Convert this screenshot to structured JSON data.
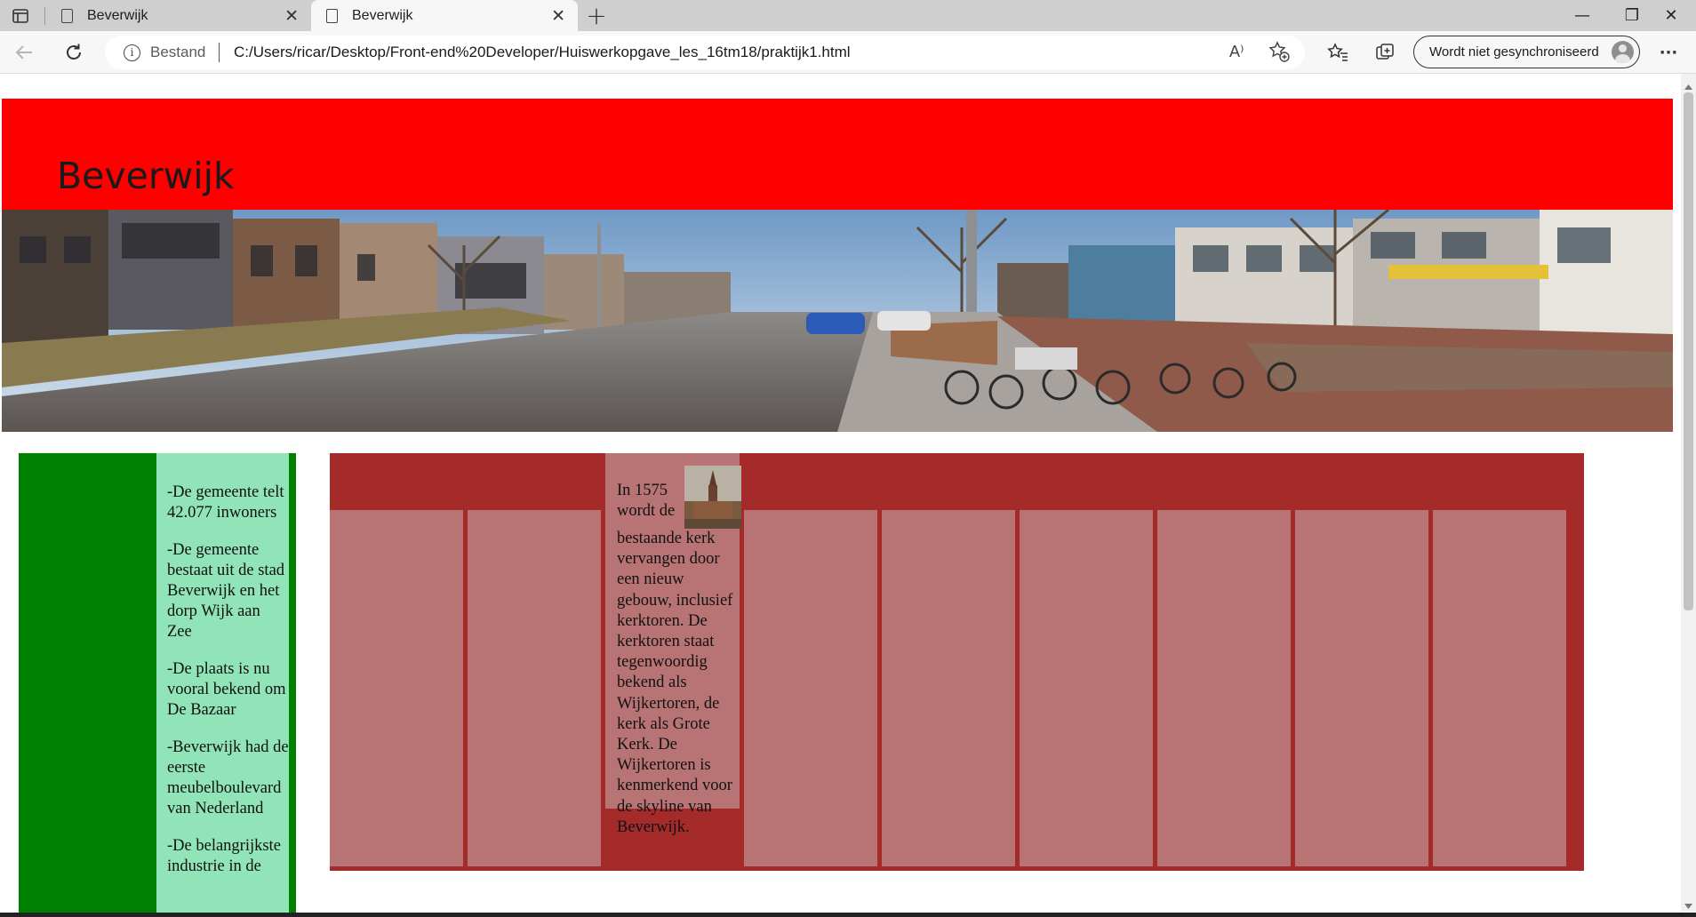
{
  "browser": {
    "tabs": [
      {
        "title": "Beverwijk",
        "active": false
      },
      {
        "title": "Beverwijk",
        "active": true
      }
    ],
    "new_tab_symbol": "+",
    "window_controls": {
      "minimize": "—",
      "maximize": "❐",
      "close": "✕"
    },
    "address": {
      "security_label": "Bestand",
      "url": "C:/Users/ricar/Desktop/Front-end%20Developer/Huiswerkopgave_les_16tm18/praktijk1.html"
    },
    "read_aloud_label": "A⁾",
    "sync_label": "Wordt niet gesynchroniseerd",
    "menu_symbol": "···"
  },
  "page": {
    "title": "Beverwijk",
    "sidebar_facts": [
      "-De gemeente telt 42.077 inwoners",
      "-De gemeente bestaat uit de stad Beverwijk en het dorp Wijk aan Zee",
      "-De plaats is nu vooral bekend om De Bazaar",
      "-Beverwijk had de eerste meubelboulevard van Nederland",
      "-De belangrijkste industrie in de"
    ],
    "feature_text": "In 1575 wordt de bestaande kerk vervangen door een nieuw gebouw, inclusief kerktoren. De kerktoren staat tegenwoordig bekend als Wijkertoren, de kerk als Grote Kerk. De Wijkertoren is kenmerkend voor de skyline van Beverwijk.",
    "colors": {
      "header": "#ff0000",
      "sidebar_outer": "#008000",
      "sidebar_inner": "#90e4b8",
      "grid_bg": "#a52a2a",
      "grid_cell": "#b87474"
    }
  }
}
